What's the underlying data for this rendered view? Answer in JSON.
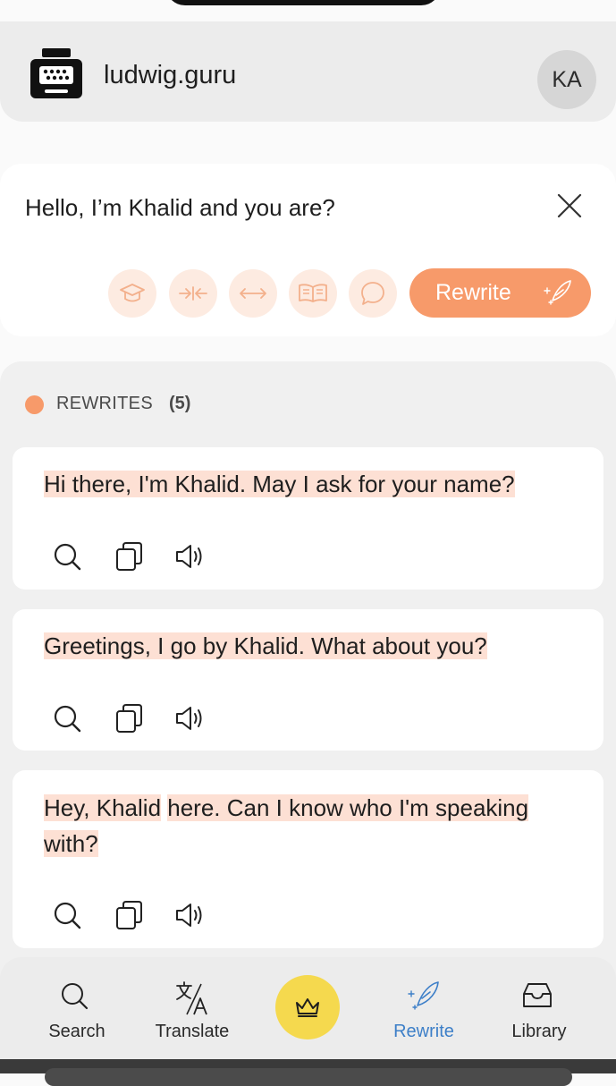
{
  "header": {
    "site_name": "ludwig.guru",
    "avatar_initials": "KA"
  },
  "input": {
    "text": "Hello, I’m Khalid and you are?",
    "tools": [
      "formal-icon",
      "shorten-icon",
      "expand-icon",
      "book-icon",
      "chat-icon"
    ],
    "rewrite_label": "Rewrite"
  },
  "results": {
    "label": "REWRITES",
    "count": "(5)",
    "items": [
      {
        "highlighted": "Hi there, I'm Khalid. May I ask for your name?",
        "rest": ""
      },
      {
        "highlighted": "Greetings, I go by Khalid. What about you?",
        "rest": ""
      },
      {
        "part1": "Hey, Khalid",
        "part2": " ",
        "part3": "here. Can I know who I'm speaking",
        "part4": "with?"
      }
    ]
  },
  "nav": {
    "items": [
      {
        "label": "Search",
        "icon": "search-icon"
      },
      {
        "label": "Translate",
        "icon": "translate-icon"
      },
      {
        "label": "",
        "icon": "crown-icon"
      },
      {
        "label": "Rewrite",
        "icon": "quill-icon"
      },
      {
        "label": "Library",
        "icon": "inbox-icon"
      }
    ]
  },
  "colors": {
    "accent": "#f79a6a",
    "highlight": "#fde0d4",
    "active_nav": "#3d7fc8",
    "premium": "#f5d94e"
  }
}
